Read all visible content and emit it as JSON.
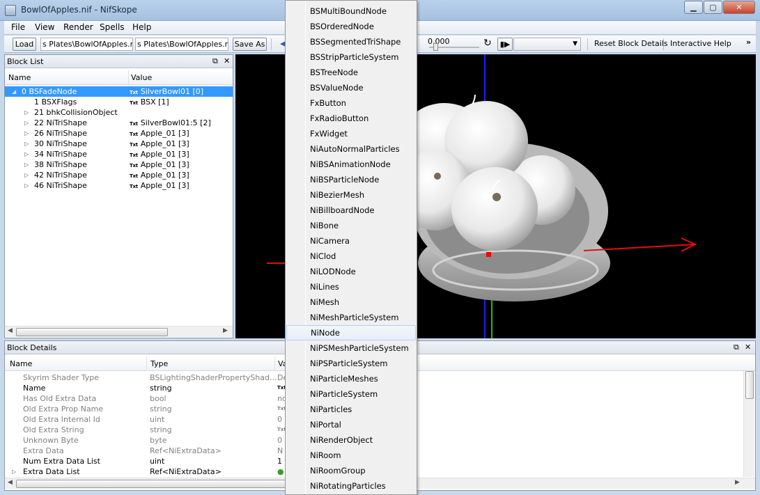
{
  "window": {
    "title": "BowlOfApples.nif - NifSkope"
  },
  "menubar": [
    "File",
    "View",
    "Render",
    "Spells",
    "Help"
  ],
  "toolbar": {
    "load_label": "Load",
    "load_path": "s Plates\\BowlOfApples.nif",
    "save_path": "s Plates\\BowlOfApples.nif",
    "save_as_label": "Save As",
    "time_value": "0.000",
    "reset_label": "Reset Block Details",
    "help_label": "Interactive Help",
    "more_glyph": "»"
  },
  "block_list": {
    "title": "Block List",
    "col_name": "Name",
    "col_value": "Value",
    "tag": "Txt",
    "rows": [
      {
        "name": "0 BSFadeNode",
        "value": "SilverBowl01 [0]",
        "txt": true,
        "arrow": "◢",
        "selected": true
      },
      {
        "name": "1 BSXFlags",
        "value": "BSX [1]",
        "txt": true,
        "arrow": ""
      },
      {
        "name": "21 bhkCollisionObject",
        "value": "",
        "txt": false,
        "arrow": "▷"
      },
      {
        "name": "22 NiTriShape",
        "value": "SilverBowl01:5 [2]",
        "txt": true,
        "arrow": "▷"
      },
      {
        "name": "26 NiTriShape",
        "value": "Apple_01 [3]",
        "txt": true,
        "arrow": "▷"
      },
      {
        "name": "30 NiTriShape",
        "value": "Apple_01 [3]",
        "txt": true,
        "arrow": "▷"
      },
      {
        "name": "34 NiTriShape",
        "value": "Apple_01 [3]",
        "txt": true,
        "arrow": "▷"
      },
      {
        "name": "38 NiTriShape",
        "value": "Apple_01 [3]",
        "txt": true,
        "arrow": "▷"
      },
      {
        "name": "42 NiTriShape",
        "value": "Apple_01 [3]",
        "txt": true,
        "arrow": "▷"
      },
      {
        "name": "46 NiTriShape",
        "value": "Apple_01 [3]",
        "txt": true,
        "arrow": "▷"
      }
    ]
  },
  "block_details": {
    "title": "Block Details",
    "col_name": "Name",
    "col_type": "Type",
    "col_value": "Va",
    "rows": [
      {
        "name": "Skyrim Shader Type",
        "type": "BSLightingShaderPropertyShad...",
        "value": "De",
        "muted": true
      },
      {
        "name": "Name",
        "type": "string",
        "value": "Txt",
        "muted": false
      },
      {
        "name": "Has Old Extra Data",
        "type": "bool",
        "value": "no",
        "muted": true
      },
      {
        "name": "Old Extra Prop Name",
        "type": "string",
        "value": "Txt",
        "muted": true
      },
      {
        "name": "Old Extra Internal Id",
        "type": "uint",
        "value": "0",
        "muted": true
      },
      {
        "name": "Old Extra String",
        "type": "string",
        "value": "Txt",
        "muted": true
      },
      {
        "name": "Unknown Byte",
        "type": "byte",
        "value": "0",
        "muted": true
      },
      {
        "name": "Extra Data",
        "type": "Ref<NiExtraData>",
        "value": "N",
        "muted": true
      },
      {
        "name": "Num Extra Data List",
        "type": "uint",
        "value": "1",
        "muted": false
      },
      {
        "name": "Extra Data List",
        "type": "Ref<NiExtraData>",
        "value": "",
        "muted": false,
        "expandable": true
      }
    ]
  },
  "dropdown": {
    "items": [
      "BSMultiBoundNode",
      "BSOrderedNode",
      "BSSegmentedTriShape",
      "BSStripParticleSystem",
      "BSTreeNode",
      "BSValueNode",
      "FxButton",
      "FxRadioButton",
      "FxWidget",
      "NiAutoNormalParticles",
      "NiBSAnimationNode",
      "NiBSParticleNode",
      "NiBezierMesh",
      "NiBillboardNode",
      "NiBone",
      "NiCamera",
      "NiClod",
      "NiLODNode",
      "NiLines",
      "NiMesh",
      "NiMeshParticleSystem",
      "NiNode",
      "NiPSMeshParticleSystem",
      "NiPSParticleSystem",
      "NiParticleMeshes",
      "NiParticleSystem",
      "NiParticles",
      "NiPortal",
      "NiRenderObject",
      "NiRoom",
      "NiRoomGroup",
      "NiRotatingParticles"
    ],
    "highlighted": "NiNode"
  },
  "colors": {
    "selection": "#3399ff",
    "viewport_bg": "#000000",
    "axis_x": "#e01010",
    "axis_y": "#18c018",
    "axis_z": "#2020ff"
  }
}
